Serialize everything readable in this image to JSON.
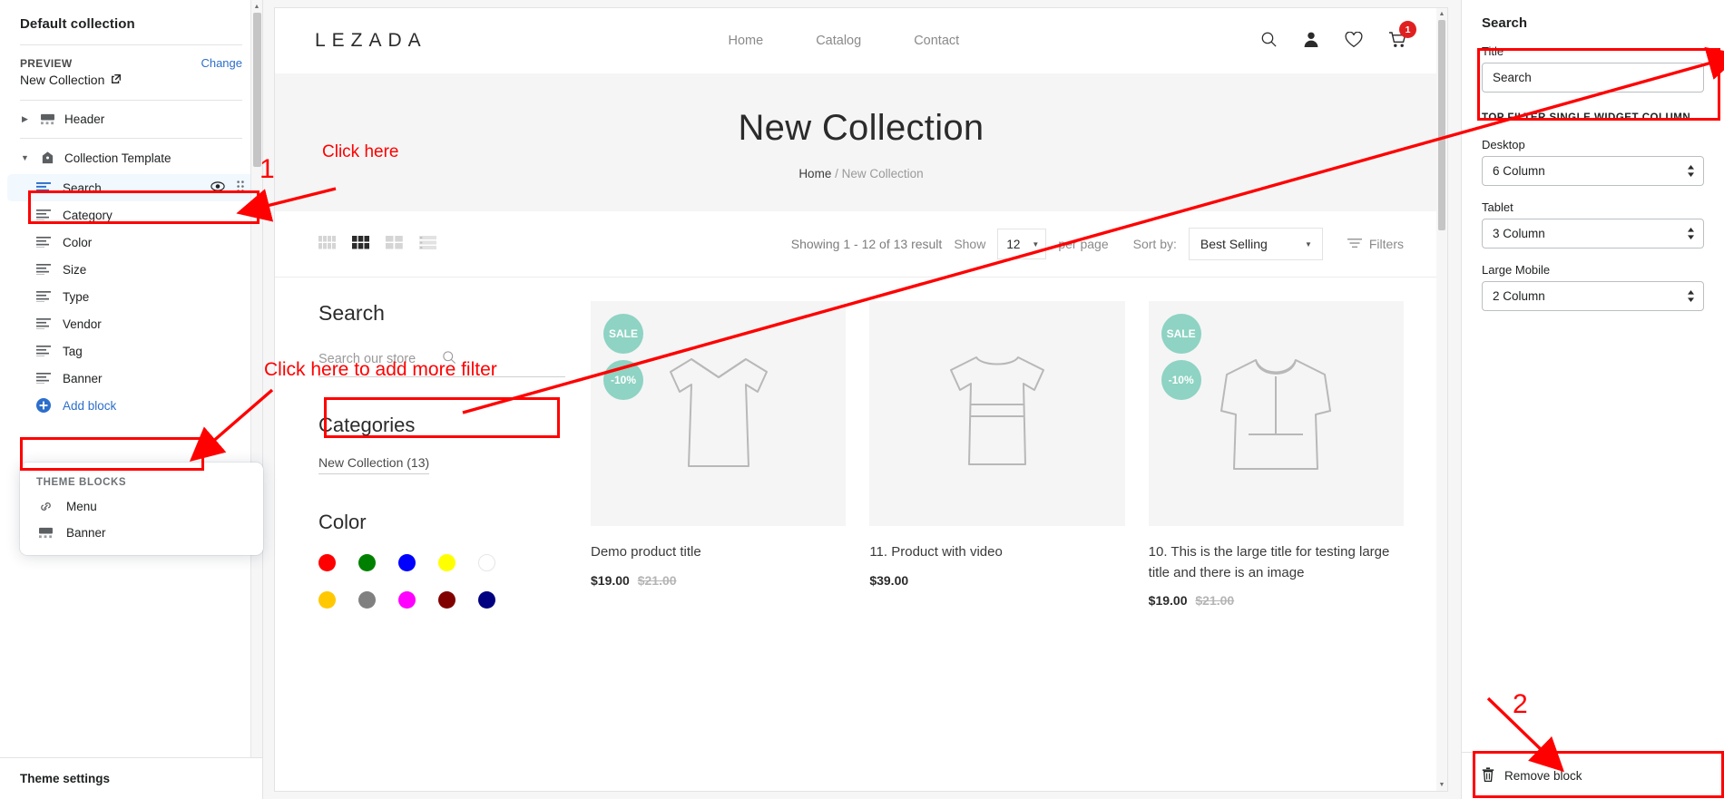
{
  "left_sidebar": {
    "title": "Default collection",
    "preview_label": "PREVIEW",
    "change_link": "Change",
    "preview_value": "New Collection",
    "tree": [
      {
        "label": "Header",
        "icon": "header-icon",
        "expanded": false
      },
      {
        "label": "Collection Template",
        "icon": "collection-icon",
        "expanded": true
      }
    ],
    "blocks": [
      {
        "label": "Search",
        "selected": true
      },
      {
        "label": "Category",
        "selected": false
      },
      {
        "label": "Color",
        "selected": false
      },
      {
        "label": "Size",
        "selected": false
      },
      {
        "label": "Type",
        "selected": false
      },
      {
        "label": "Vendor",
        "selected": false
      },
      {
        "label": "Tag",
        "selected": false
      },
      {
        "label": "Banner",
        "selected": false
      }
    ],
    "add_block_label": "Add block",
    "flyout": {
      "header": "THEME BLOCKS",
      "items": [
        {
          "label": "Menu",
          "icon": "link-icon"
        },
        {
          "label": "Banner",
          "icon": "banner-icon"
        }
      ]
    },
    "footer_label": "Theme settings"
  },
  "preview": {
    "brand": "LEZADA",
    "nav": [
      "Home",
      "Catalog",
      "Contact"
    ],
    "header_icons": [
      "search-icon",
      "account-icon",
      "wishlist-icon",
      "cart-icon"
    ],
    "cart_count": "1",
    "hero_title": "New Collection",
    "breadcrumb_home": "Home",
    "breadcrumb_sep": "/",
    "breadcrumb_current": "New Collection",
    "toolbar": {
      "showing": "Showing 1 - 12 of 13 result",
      "show_label": "Show",
      "show_value": "12",
      "per_page_label": "per page",
      "sort_label": "Sort by:",
      "sort_value": "Best Selling",
      "filters_label": "Filters",
      "active_view_index": 1
    },
    "filter_col": {
      "search_title": "Search",
      "search_placeholder": "Search our store",
      "categories_title": "Categories",
      "category_item": "New Collection (13)",
      "color_title": "Color",
      "swatches": [
        "#ff0000",
        "#008000",
        "#0000ff",
        "#ffff00",
        "#ffffff",
        "#ffc800",
        "#808080",
        "#ff00ff",
        "#800000",
        "#000080"
      ]
    },
    "products": [
      {
        "title": "Demo product title",
        "price": "$19.00",
        "compare_at": "$21.00",
        "badges": [
          "SALE",
          "-10%"
        ],
        "image": "tshirt-vneck-outline"
      },
      {
        "title": "11. Product with video",
        "price": "$39.00",
        "compare_at": "",
        "badges": [],
        "image": "tshirt-crew-outline"
      },
      {
        "title": "10. This is the large title for testing large title and there is an image",
        "price": "$19.00",
        "compare_at": "$21.00",
        "badges": [
          "SALE",
          "-10%"
        ],
        "image": "hoodie-outline"
      }
    ]
  },
  "right_sidebar": {
    "title": "Search",
    "title_field_label": "Title",
    "title_field_value": "Search",
    "section_header": "TOP FILTER SINGLE WIDGET COLUMN",
    "fields": [
      {
        "label": "Desktop",
        "value": "6 Column"
      },
      {
        "label": "Tablet",
        "value": "3 Column"
      },
      {
        "label": "Large Mobile",
        "value": "2 Column"
      }
    ],
    "remove_block_label": "Remove block"
  },
  "annotations": {
    "step_one": "1",
    "step_two": "2",
    "click_here": "Click here",
    "click_here_more": "Click here to add more filter"
  },
  "colors": {
    "annotation_red": "#ff0000",
    "accent_blue": "#2c6ecb",
    "badge_teal": "#8ed3c3",
    "cart_badge_red": "#e02020"
  }
}
